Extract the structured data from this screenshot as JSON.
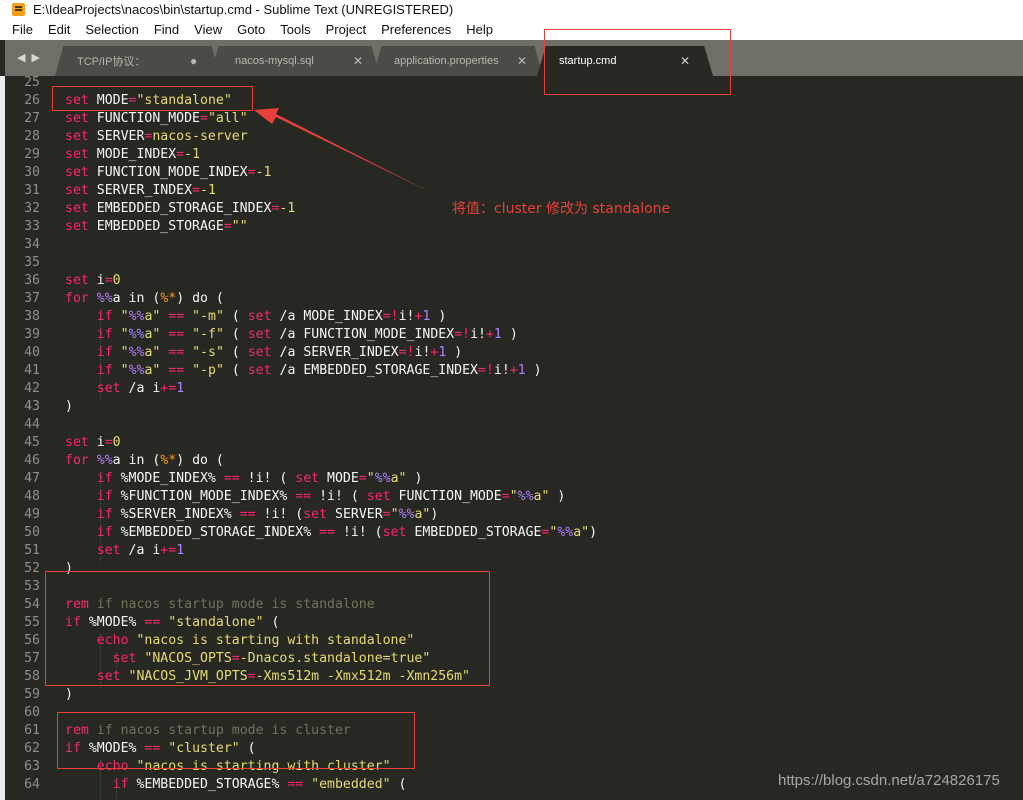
{
  "window": {
    "title": "E:\\IdeaProjects\\nacos\\bin\\startup.cmd - Sublime Text (UNREGISTERED)",
    "app_icon": "sublime-text-icon"
  },
  "menu": [
    "File",
    "Edit",
    "Selection",
    "Find",
    "View",
    "Goto",
    "Tools",
    "Project",
    "Preferences",
    "Help"
  ],
  "tabs": [
    {
      "label": "TCP/IP协议：",
      "state": "modified",
      "indicator": "●"
    },
    {
      "label": "nacos-mysql.sql",
      "state": "saved",
      "indicator": "✕"
    },
    {
      "label": "application.properties",
      "state": "saved",
      "indicator": "✕"
    },
    {
      "label": "startup.cmd",
      "state": "active",
      "indicator": "✕"
    }
  ],
  "tab_nav": {
    "prev": "◀",
    "next": "▶"
  },
  "editor": {
    "lines": [
      {
        "n": "25",
        "html": ""
      },
      {
        "n": "26",
        "html": "<span class='k'>set</span> MODE<span class='o'>=</span><span class='s'>\"standalone\"</span>"
      },
      {
        "n": "27",
        "html": "<span class='k'>set</span> FUNCTION_MODE<span class='o'>=</span><span class='s'>\"all\"</span>"
      },
      {
        "n": "28",
        "html": "<span class='k'>set</span> SERVER<span class='o'>=</span><span class='s'>nacos-server</span>"
      },
      {
        "n": "29",
        "html": "<span class='k'>set</span> MODE_INDEX<span class='o'>=</span><span class='s'>-1</span>"
      },
      {
        "n": "30",
        "html": "<span class='k'>set</span> FUNCTION_MODE_INDEX<span class='o'>=</span><span class='s'>-1</span>"
      },
      {
        "n": "31",
        "html": "<span class='k'>set</span> SERVER_INDEX<span class='o'>=</span><span class='s'>-1</span>"
      },
      {
        "n": "32",
        "html": "<span class='k'>set</span> EMBEDDED_STORAGE_INDEX<span class='o'>=</span><span class='s'>-1</span>"
      },
      {
        "n": "33",
        "html": "<span class='k'>set</span> EMBEDDED_STORAGE<span class='o'>=</span><span class='s'>\"\"</span>"
      },
      {
        "n": "34",
        "html": ""
      },
      {
        "n": "35",
        "html": ""
      },
      {
        "n": "36",
        "html": "<span class='k'>set</span> i<span class='o'>=</span><span class='s'>0</span>"
      },
      {
        "n": "37",
        "html": "<span class='k'>for</span> <span class='v'>%%</span>a in (<span class='pct'>%*</span>) do ("
      },
      {
        "n": "38",
        "html": "    <span class='k'>if</span> <span class='s'>\"</span><span class='v'>%%</span><span class='s'>a\"</span> <span class='o'>==</span> <span class='s'>\"-m\"</span> ( <span class='k'>set</span> /a MODE_INDEX<span class='o'>=!</span>i!<span class='o'>+</span><span class='n'>1</span> )"
      },
      {
        "n": "39",
        "html": "    <span class='k'>if</span> <span class='s'>\"</span><span class='v'>%%</span><span class='s'>a\"</span> <span class='o'>==</span> <span class='s'>\"-f\"</span> ( <span class='k'>set</span> /a FUNCTION_MODE_INDEX<span class='o'>=!</span>i!<span class='o'>+</span><span class='n'>1</span> )"
      },
      {
        "n": "40",
        "html": "    <span class='k'>if</span> <span class='s'>\"</span><span class='v'>%%</span><span class='s'>a\"</span> <span class='o'>==</span> <span class='s'>\"-s\"</span> ( <span class='k'>set</span> /a SERVER_INDEX<span class='o'>=!</span>i!<span class='o'>+</span><span class='n'>1</span> )"
      },
      {
        "n": "41",
        "html": "    <span class='k'>if</span> <span class='s'>\"</span><span class='v'>%%</span><span class='s'>a\"</span> <span class='o'>==</span> <span class='s'>\"-p\"</span> ( <span class='k'>set</span> /a EMBEDDED_STORAGE_INDEX<span class='o'>=!</span>i!<span class='o'>+</span><span class='n'>1</span> )"
      },
      {
        "n": "42",
        "html": "    <span class='k'>set</span> /a i<span class='o'>+=</span><span class='n'>1</span>"
      },
      {
        "n": "43",
        "html": ")"
      },
      {
        "n": "44",
        "html": ""
      },
      {
        "n": "45",
        "html": "<span class='k'>set</span> i<span class='o'>=</span><span class='s'>0</span>"
      },
      {
        "n": "46",
        "html": "<span class='k'>for</span> <span class='v'>%%</span>a in (<span class='pct'>%*</span>) do ("
      },
      {
        "n": "47",
        "html": "    <span class='k'>if</span> %MODE_INDEX% <span class='o'>==</span> !i! ( <span class='k'>set</span> MODE<span class='o'>=</span><span class='s'>\"</span><span class='v'>%%</span><span class='s'>a\"</span> )"
      },
      {
        "n": "48",
        "html": "    <span class='k'>if</span> %FUNCTION_MODE_INDEX% <span class='o'>==</span> !i! ( <span class='k'>set</span> FUNCTION_MODE<span class='o'>=</span><span class='s'>\"</span><span class='v'>%%</span><span class='s'>a\"</span> )"
      },
      {
        "n": "49",
        "html": "    <span class='k'>if</span> %SERVER_INDEX% <span class='o'>==</span> !i! (<span class='k'>set</span> SERVER<span class='o'>=</span><span class='s'>\"</span><span class='v'>%%</span><span class='s'>a\"</span>)"
      },
      {
        "n": "50",
        "html": "    <span class='k'>if</span> %EMBEDDED_STORAGE_INDEX% <span class='o'>==</span> !i! (<span class='k'>set</span> EMBEDDED_STORAGE<span class='o'>=</span><span class='s'>\"</span><span class='v'>%%</span><span class='s'>a\"</span>)"
      },
      {
        "n": "51",
        "html": "    <span class='k'>set</span> /a i<span class='o'>+=</span><span class='n'>1</span>"
      },
      {
        "n": "52",
        "html": ")"
      },
      {
        "n": "53",
        "html": ""
      },
      {
        "n": "54",
        "html": "<span class='k'>rem</span> <span class='c'>if nacos startup mode is standalone</span>"
      },
      {
        "n": "55",
        "html": "<span class='k'>if</span> %MODE% <span class='o'>==</span> <span class='s'>\"standalone\"</span> ("
      },
      {
        "n": "56",
        "html": "    <span class='k'>echo</span> <span class='s'>\"nacos is starting with standalone\"</span>"
      },
      {
        "n": "57",
        "html": "      <span class='k'>set</span> <span class='s'>\"NACOS_OPTS</span><span class='o'>=</span><span class='s'>-Dnacos.standalone=true\"</span>"
      },
      {
        "n": "58",
        "html": "    <span class='k'>set</span> <span class='s'>\"NACOS_JVM_OPTS</span><span class='o'>=</span><span class='s'>-Xms512m -Xmx512m -Xmn256m\"</span>"
      },
      {
        "n": "59",
        "html": ")"
      },
      {
        "n": "60",
        "html": ""
      },
      {
        "n": "61",
        "html": "<span class='k'>rem</span> <span class='c'>if nacos startup mode is cluster</span>"
      },
      {
        "n": "62",
        "html": "<span class='k'>if</span> %MODE% <span class='o'>==</span> <span class='s'>\"cluster\"</span> ("
      },
      {
        "n": "63",
        "html": "    <span class='k'>echo</span> <span class='s'>\"nacos is starting with cluster\"</span>"
      },
      {
        "n": "64",
        "html": "      <span class='k'>if</span> %EMBEDDED_STORAGE% <span class='o'>==</span> <span class='s'>\"embedded\"</span> ("
      }
    ]
  },
  "annotation": {
    "note": "将值：cluster 修改为 standalone",
    "color": "#e8413b"
  },
  "watermark": "https://blog.csdn.net/a724826175",
  "colors": {
    "editor_bg": "#272822",
    "keyword": "#f92672",
    "string": "#e6db74",
    "number": "#ae81ff",
    "comment": "#75715e",
    "annotation_red": "#e8413b"
  }
}
